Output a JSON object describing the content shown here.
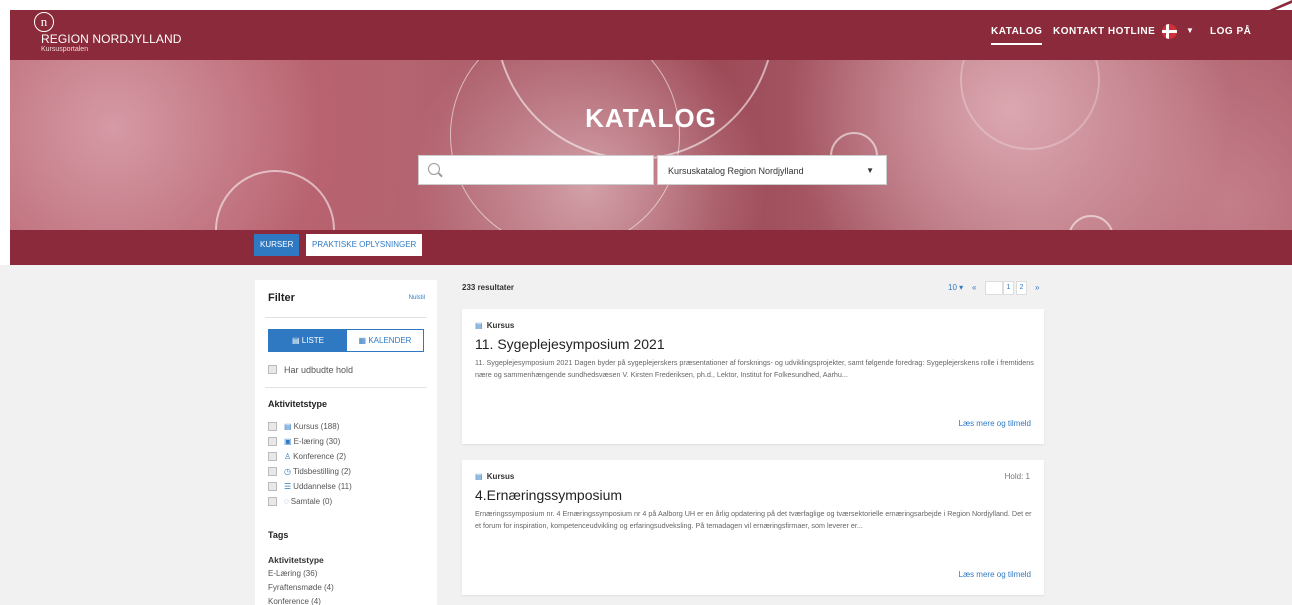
{
  "header": {
    "logo_mark": "n",
    "brand": "REGION NORDJYLLAND",
    "sub": "Kursusportalen",
    "nav": {
      "katalog": "KATALOG",
      "hotline": "KONTAKT HOTLINE",
      "login": "LOG PÅ"
    },
    "lang_caret": "▼"
  },
  "hero": {
    "title": "KATALOG",
    "search_placeholder": "",
    "catalog_select": "Kursuskatalog Region Nordjylland",
    "select_caret": "▼"
  },
  "tabs": {
    "kurser": "KURSER",
    "praktiske": "PRAKTISKE OPLYSNINGER"
  },
  "filter": {
    "title": "Filter",
    "reset": "Nulstil",
    "view_liste": "LISTE",
    "view_kalender": "KALENDER",
    "has_offered": "Har udbudte hold",
    "activity_heading": "Aktivitetstype",
    "activity_items": [
      {
        "icon": "▤",
        "label": "Kursus (188)"
      },
      {
        "icon": "▣",
        "label": "E-læring (30)"
      },
      {
        "icon": "♙",
        "label": "Konference (2)"
      },
      {
        "icon": "◷",
        "label": "Tidsbestilling (2)"
      },
      {
        "icon": "☰",
        "label": "Uddannelse (11)"
      },
      {
        "icon": "◌",
        "label": "Samtale (0)"
      }
    ],
    "tags_heading": "Tags",
    "tags_sub": "Aktivitetstype",
    "tags": [
      "E-Læring (36)",
      "Fyraftensmøde (4)",
      "Konference (4)"
    ]
  },
  "results": {
    "count": "233 resultater",
    "per_page": "10 ▾",
    "prev": "«",
    "pages": [
      "1",
      "2"
    ],
    "next": "»",
    "cards": [
      {
        "type": "Kursus",
        "hold": "",
        "title": "11. Sygeplejesymposium 2021",
        "desc": "11. Sygeplejesymposium 2021  Dagen byder på sygeplejerskers præsentationer af forsknings- og udviklingsprojekter, samt følgende foredrag: Sygeplejerskens rolle i fremtidens nære og sammenhængende sundhedsvæsen V. Kirsten Frederiksen, ph.d., Lektor, Institut for Folkesundhed, Aarhu...",
        "link": "Læs mere og tilmeld"
      },
      {
        "type": "Kursus",
        "hold": "Hold: 1",
        "title": "4.Ernæringssymposium",
        "desc": "Ernæringssymposium nr. 4 Ernæringssymposium nr 4 på Aalborg UH er en årlig opdatering på det tværfaglige og tværsektorielle ernæringsarbejde i Region Nordjylland. Det er et forum for inspiration, kompetenceudvikling og erfaringsudveksling.  På temadagen vil ernæringsfirmaer, som leverer er...",
        "link": "Læs mere og tilmeld"
      }
    ]
  },
  "colors": {
    "brand": "#8a2a3a",
    "accent": "#2f79c2",
    "content_bg": "#f1f1f1"
  }
}
